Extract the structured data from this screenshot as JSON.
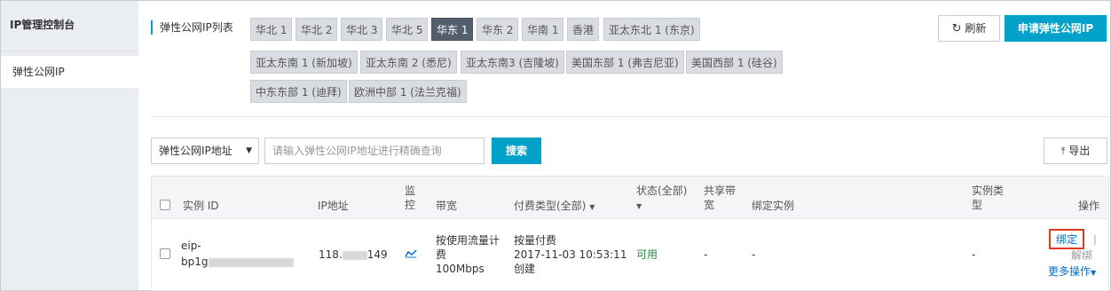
{
  "sidebar": {
    "title": "IP管理控制台",
    "items": [
      {
        "label": "弹性公网IP"
      }
    ]
  },
  "header": {
    "list_label": "弹性公网IP列表",
    "regions": [
      {
        "label": "华北 1",
        "active": false
      },
      {
        "label": "华北 2",
        "active": false
      },
      {
        "label": "华北 3",
        "active": false
      },
      {
        "label": "华北 5",
        "active": false
      },
      {
        "label": "华东 1",
        "active": true
      },
      {
        "label": "华东 2",
        "active": false
      },
      {
        "label": "华南 1",
        "active": false
      },
      {
        "label": "香港",
        "active": false
      },
      {
        "label": "亚太东北 1 (东京)",
        "active": false
      },
      {
        "label": "亚太东南 1 (新加坡)",
        "active": false
      },
      {
        "label": "亚太东南 2 (悉尼)",
        "active": false
      },
      {
        "label": "亚太东南3 (吉隆坡)",
        "active": false
      },
      {
        "label": "美国东部 1 (弗吉尼亚)",
        "active": false
      },
      {
        "label": "美国西部 1 (硅谷)",
        "active": false
      },
      {
        "label": "中东东部 1 (迪拜)",
        "active": false
      },
      {
        "label": "欧洲中部 1 (法兰克福)",
        "active": false
      }
    ],
    "refresh_label": "刷新",
    "apply_label": "申请弹性公网IP"
  },
  "toolbar": {
    "select_value": "弹性公网IP地址",
    "search_placeholder": "请输入弹性公网IP地址进行精确查询",
    "search_label": "搜索",
    "export_label": "导出"
  },
  "table": {
    "headers": {
      "instance_id": "实例 ID",
      "ip": "IP地址",
      "monitor": "监控",
      "bandwidth": "带宽",
      "billing": "付费类型(全部)",
      "status": "状态(全部)",
      "shared": "共享带宽",
      "bound": "绑定实例",
      "instance_type": "实例类型",
      "actions": "操作"
    },
    "rows": [
      {
        "instance_id_prefix": "eip-",
        "instance_id_second": "bp1g",
        "ip_prefix": "118.",
        "ip_suffix": "149",
        "bandwidth_line1": "按使用流量计",
        "bandwidth_line2": "费",
        "bandwidth_value": "100Mbps",
        "billing_type": "按量付费",
        "created_at": "2017-11-03 10:53:11",
        "created_label": "创建",
        "status": "可用",
        "shared": "-",
        "bound": "-",
        "instance_type": "-",
        "action_bind": "绑定",
        "action_unbind": "解绑",
        "action_more": "更多操作"
      }
    ]
  },
  "colors": {
    "accent": "#00a2ca",
    "active_region": "#545f6e",
    "status_ok": "#1e8e3e",
    "link": "#0070cc",
    "highlight": "#e2391c"
  }
}
